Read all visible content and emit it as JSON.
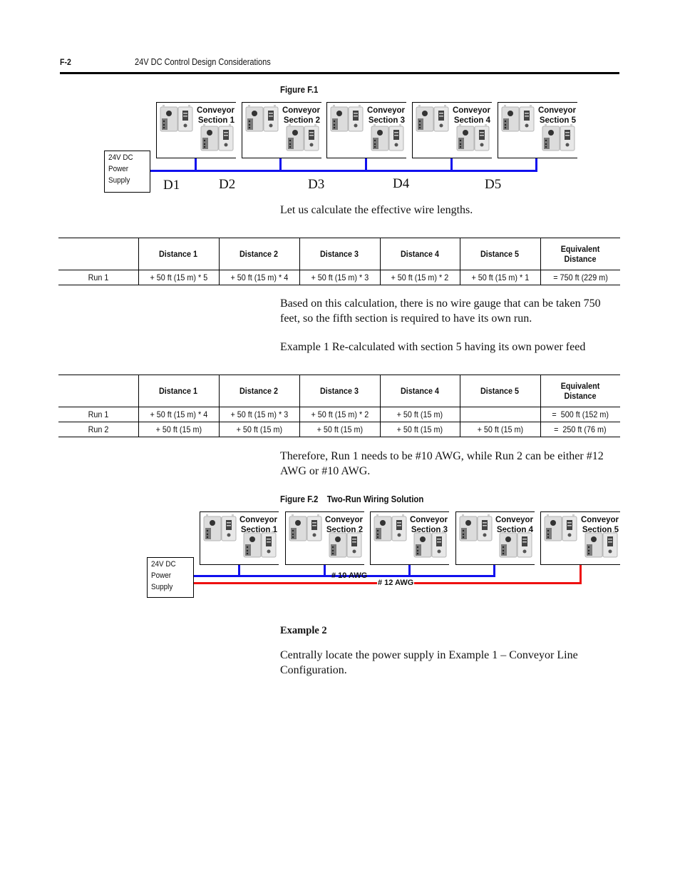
{
  "header": {
    "page_number": "F-2",
    "section_title": "24V DC Control Design Considerations"
  },
  "figure1": {
    "caption": "Figure F.1",
    "power_supply": [
      "24V DC",
      "Power",
      "Supply"
    ],
    "sections": [
      [
        "Conveyor",
        "Section 1"
      ],
      [
        "Conveyor",
        "Section 2"
      ],
      [
        "Conveyor",
        "Section 3"
      ],
      [
        "Conveyor",
        "Section 4"
      ],
      [
        "Conveyor",
        "Section 5"
      ]
    ],
    "distance_labels": [
      "D1",
      "D2",
      "D3",
      "D4",
      "D5"
    ],
    "wire_color": "#1010ee"
  },
  "intro_text": "Let us calculate the effective wire lengths.",
  "table1": {
    "headers": [
      "",
      "Distance 1",
      "Distance 2",
      "Distance 3",
      "Distance 4",
      "Distance 5",
      "Equivalent Distance"
    ],
    "rows": [
      [
        "Run 1",
        "+ 50 ft (15 m) * 5",
        "+ 50 ft (15 m) * 4",
        "+ 50 ft (15 m) * 3",
        "+ 50 ft (15 m) * 2",
        "+ 50 ft (15 m) * 1",
        "= 750 ft (229 m)"
      ]
    ]
  },
  "paragraph1": "Based on this calculation, there is no wire gauge that can be taken 750 feet, so the fifth section is required to have its own run.",
  "paragraph2": "Example 1 Re-calculated with section 5 having its own power feed",
  "table2": {
    "headers": [
      "",
      "Distance 1",
      "Distance 2",
      "Distance 3",
      "Distance 4",
      "Distance 5",
      "Equivalent Distance"
    ],
    "rows": [
      [
        "Run 1",
        "+ 50 ft (15 m) * 4",
        "+ 50 ft (15 m) * 3",
        "+ 50 ft (15 m) * 2",
        "+ 50 ft (15 m)",
        "",
        "=  500 ft (152 m)"
      ],
      [
        "Run 2",
        "+ 50 ft (15 m)",
        "+ 50 ft (15 m)",
        "+ 50 ft (15 m)",
        "+ 50 ft (15 m)",
        "+ 50 ft (15 m)",
        "=  250 ft (76 m)"
      ]
    ]
  },
  "paragraph3": "Therefore, Run 1 needs to be #10 AWG, while Run 2 can be either #12 AWG or #10 AWG.",
  "figure2": {
    "caption_number": "Figure F.2",
    "caption_title": "Two-Run Wiring Solution",
    "power_supply": [
      "24V DC",
      "Power",
      "Supply"
    ],
    "sections": [
      [
        "Conveyor",
        "Section 1"
      ],
      [
        "Conveyor",
        "Section 2"
      ],
      [
        "Conveyor",
        "Section 3"
      ],
      [
        "Conveyor",
        "Section 4"
      ],
      [
        "Conveyor",
        "Section 5"
      ]
    ],
    "wire1_label": "# 10 AWG",
    "wire2_label": "# 12 AWG",
    "wire1_color": "#1010ee",
    "wire2_color": "#ee1010"
  },
  "example2": {
    "heading": "Example 2",
    "text": "Centrally locate the power supply in Example 1 – Conveyor Line Configuration."
  }
}
